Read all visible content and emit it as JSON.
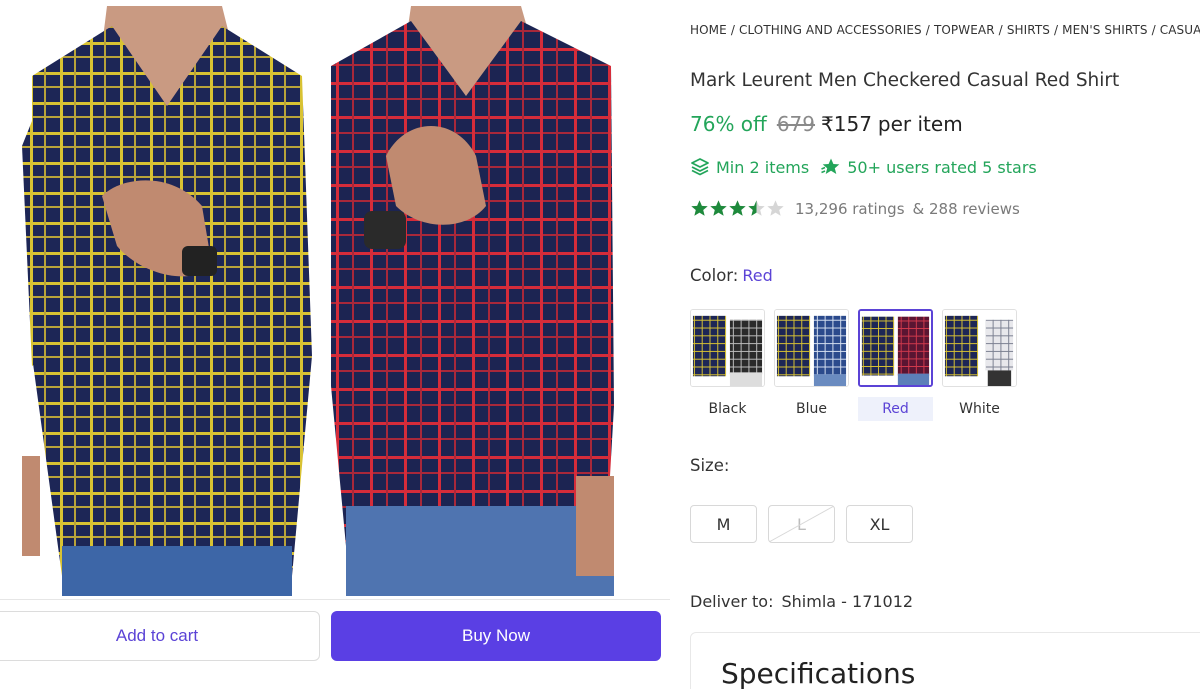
{
  "actions": {
    "add_to_cart_label": "Add to cart",
    "buy_now_label": "Buy Now"
  },
  "breadcrumb": [
    "HOME",
    "CLOTHING AND ACCESSORIES",
    "TOPWEAR",
    "SHIRTS",
    "MEN'S SHIRTS",
    "CASUAL SHIRTS"
  ],
  "product": {
    "title": "Mark Leurent Men Checkered Casual Red Shirt",
    "discount": "76% off",
    "mrp": "679",
    "price": "₹157",
    "price_unit": "per item",
    "min_items": "Min 2 items",
    "rated_text": "50+ users rated 5 stars",
    "rating_value": 3.5,
    "rating_max": 5,
    "ratings_count": "13,296 ratings",
    "reviews_count": "& 288 reviews"
  },
  "color": {
    "label": "Color:",
    "selected": "Red",
    "options": [
      {
        "name": "Black",
        "selected": false
      },
      {
        "name": "Blue",
        "selected": false
      },
      {
        "name": "Red",
        "selected": true
      },
      {
        "name": "White",
        "selected": false
      }
    ]
  },
  "size": {
    "label": "Size:",
    "options": [
      {
        "name": "M",
        "available": true
      },
      {
        "name": "L",
        "available": false
      },
      {
        "name": "XL",
        "available": true
      }
    ]
  },
  "delivery": {
    "label": "Deliver to:",
    "location": "Shimla - 171012"
  },
  "specifications": {
    "title": "Specifications"
  },
  "colors": {
    "accent": "#5b43d6",
    "buy_button": "#5a3fe4",
    "green": "#23a55a",
    "star": "#1e8a3c"
  },
  "icons": {
    "min_items": "layers-icon",
    "rated": "star-badge-icon"
  }
}
